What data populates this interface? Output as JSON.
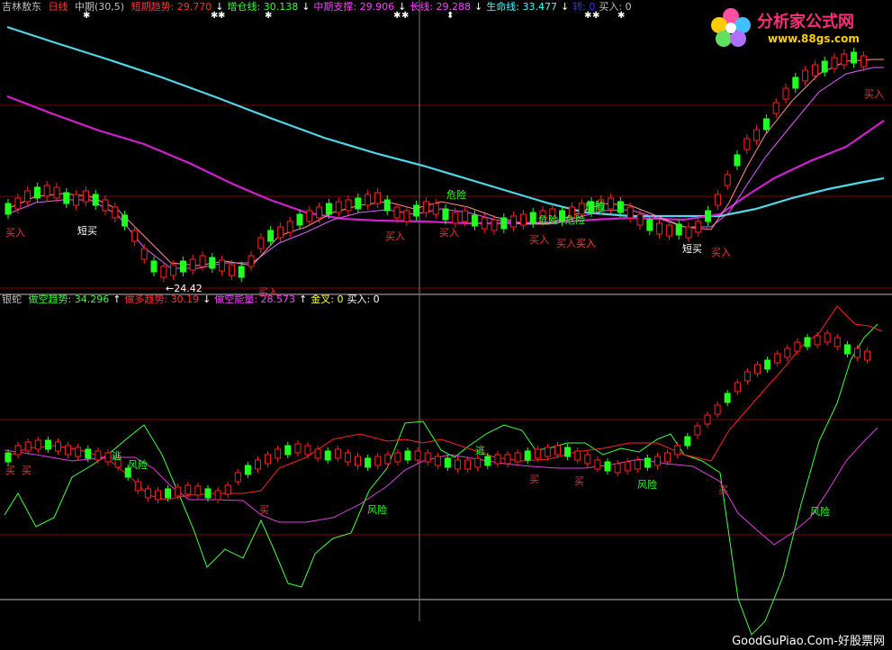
{
  "header1": {
    "stock": "吉林敖东",
    "period": "日线",
    "indicator": "中期(30,5)",
    "items": [
      {
        "label": "短期趋势: 29.770",
        "color": "#ff3030"
      },
      {
        "label": "↓",
        "color": "#ffffff"
      },
      {
        "label": "增仓线: 30.138",
        "color": "#30ff30"
      },
      {
        "label": "↓",
        "color": "#ffffff"
      },
      {
        "label": "中期支撑: 29.906",
        "color": "#ff40ff"
      },
      {
        "label": "↓",
        "color": "#ffffff"
      },
      {
        "label": "长线: 29.288",
        "color": "#ff40ff"
      },
      {
        "label": "↓",
        "color": "#ffffff"
      },
      {
        "label": "生命线: 33.477",
        "color": "#40ffff"
      },
      {
        "label": "↓",
        "color": "#ffffff"
      },
      {
        "label": "转: 0",
        "color": "#3030ff"
      },
      {
        "label": "买入: 0",
        "color": "#c0c0c0"
      }
    ]
  },
  "header2": {
    "name": "银蛇",
    "items": [
      {
        "label": "做空趋势: 34.296",
        "color": "#30ff30"
      },
      {
        "label": "↑",
        "color": "#ffffff"
      },
      {
        "label": "做多趋势: 30.19",
        "color": "#ff3030"
      },
      {
        "label": "↓",
        "color": "#ffffff"
      },
      {
        "label": "做空能量: 28.573",
        "color": "#ff40ff"
      },
      {
        "label": "↑",
        "color": "#ffffff"
      },
      {
        "label": "金叉: 0",
        "color": "#ffff40"
      },
      {
        "label": "买入: 0",
        "color": "#ffffff"
      }
    ]
  },
  "logo": {
    "brand": "分析家公式网",
    "url": "www.88gs.com"
  },
  "footer": "GoodGuPiao.Com-好股票网",
  "price_note": "←24.42",
  "signals_top": [
    {
      "text": "买入",
      "color": "#ff3030"
    },
    {
      "text": "短买",
      "color": "#ffffff"
    },
    {
      "text": "买入",
      "color": "#ff3030"
    },
    {
      "text": "买入",
      "color": "#ff3030"
    },
    {
      "text": "买入",
      "color": "#ff3030"
    },
    {
      "text": "危险",
      "color": "#30ff30"
    },
    {
      "text": "买入",
      "color": "#ff3030"
    },
    {
      "text": "危险",
      "color": "#30ff30"
    },
    {
      "text": "买入",
      "color": "#ff3030"
    },
    {
      "text": "危险",
      "color": "#30ff30"
    },
    {
      "text": "危险",
      "color": "#30ff30"
    },
    {
      "text": "买入",
      "color": "#ff3030"
    },
    {
      "text": "危险",
      "color": "#30ff30"
    },
    {
      "text": "短买",
      "color": "#ffffff"
    },
    {
      "text": "买入",
      "color": "#ff3030"
    },
    {
      "text": "买入",
      "color": "#ff3030"
    },
    {
      "text": "买入",
      "color": "#ff3030"
    }
  ],
  "signals_bottom": [
    {
      "text": "买",
      "color": "#ff3030"
    },
    {
      "text": "买",
      "color": "#ff3030"
    },
    {
      "text": "逃",
      "color": "#30ff30"
    },
    {
      "text": "风险",
      "color": "#30ff30"
    },
    {
      "text": "买",
      "color": "#ff3030"
    },
    {
      "text": "风险",
      "color": "#30ff30"
    },
    {
      "text": "逃",
      "color": "#30ff30"
    },
    {
      "text": "买",
      "color": "#ff3030"
    },
    {
      "text": "买",
      "color": "#ff3030"
    },
    {
      "text": "风险",
      "color": "#30ff30"
    },
    {
      "text": "买",
      "color": "#ff3030"
    },
    {
      "text": "风险",
      "color": "#30ff30"
    }
  ],
  "colors": {
    "up": "#ff2020",
    "down": "#20ff20",
    "life_line": "#50d8e8",
    "long_line": "#d020d0",
    "grid": "#800000"
  }
}
